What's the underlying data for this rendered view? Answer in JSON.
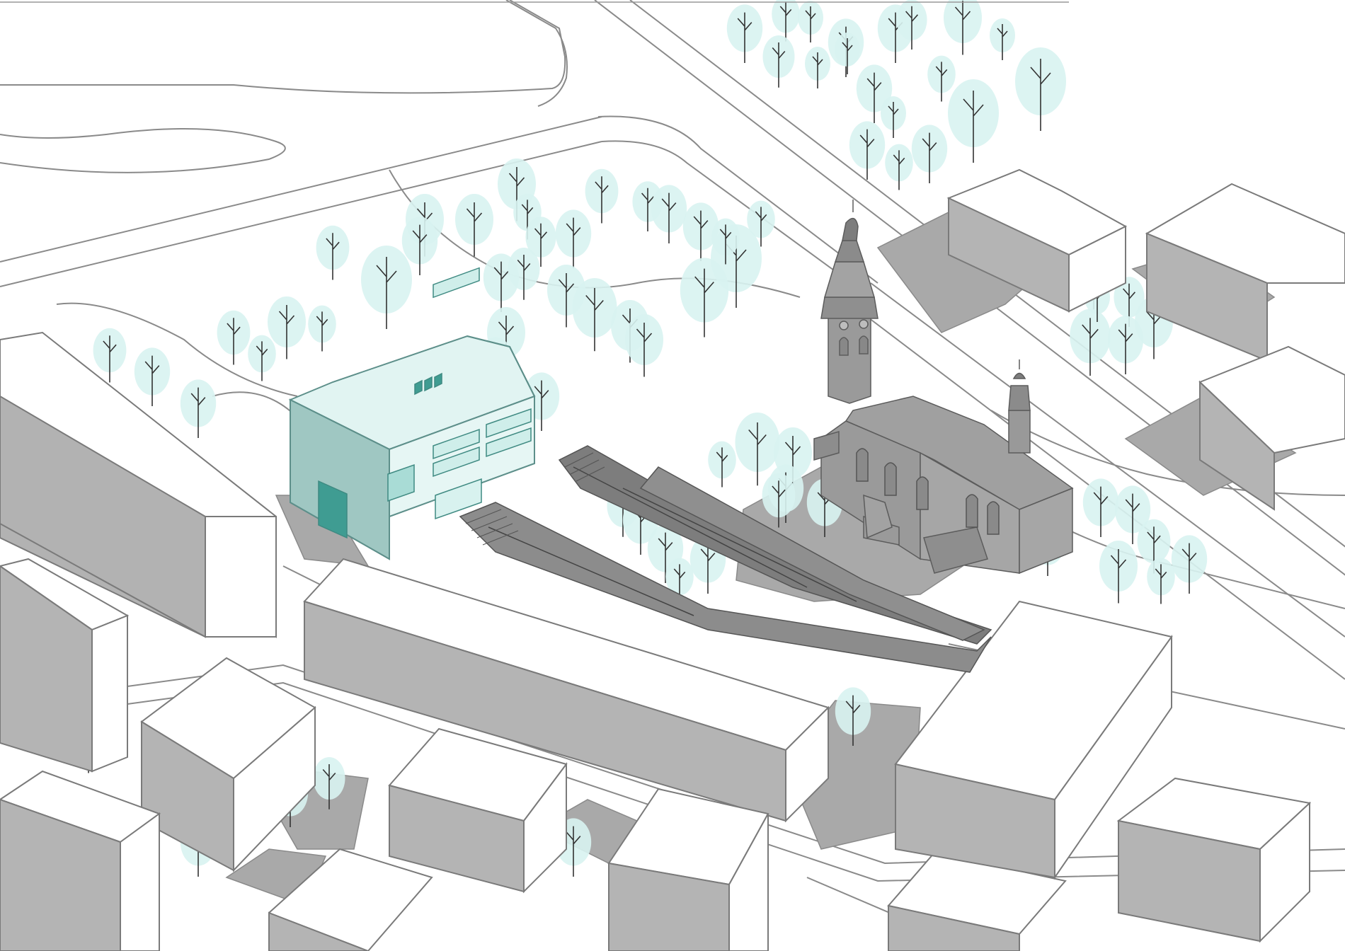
{
  "diagram": {
    "type": "axonometric-site-plan",
    "labels": [],
    "colors": {
      "background": "#ffffff",
      "ground_line": "#808080",
      "building_face_light": "#ffffff",
      "building_face_side": "#b4b4b4",
      "shadow": "#a8a8a8",
      "church": "#9a9a9a",
      "church_dark": "#7d7d7d",
      "highlight_building": "#dff4f2",
      "highlight_building_side": "#8fb8b4",
      "highlight_building_dark": "#3f9c92",
      "tree_canopy": "#d8f3f1",
      "tree_trunk": "#333333",
      "ramp": "#8c8c8c",
      "ramp_dark": "#6a6a6a"
    },
    "elements": {
      "highlighted_building": "new-building-teal",
      "church": "baroque-church-with-two-towers",
      "ramps": "diagonal-stair-ramps",
      "trees": "deciduous-tree-symbols",
      "blocks": "neighbouring-block-buildings"
    }
  }
}
